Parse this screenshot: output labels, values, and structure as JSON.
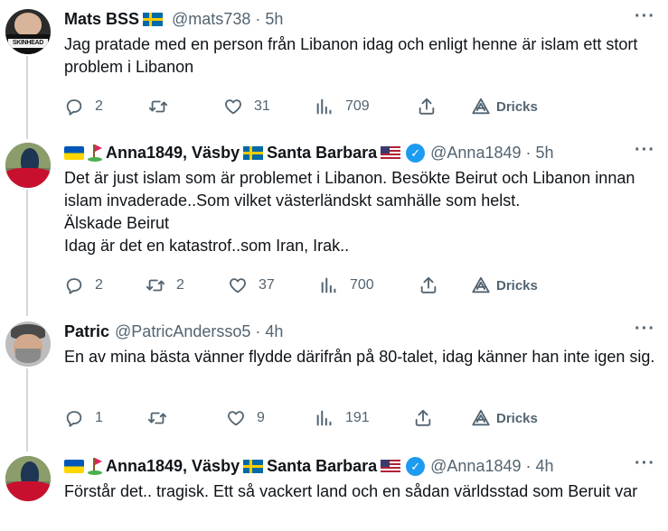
{
  "tweets": [
    {
      "name": "Mats BSS",
      "handle": "@mats738",
      "dot": "·",
      "time": "5h",
      "more": "···",
      "text": "Jag pratade med en person från Libanon idag och enligt henne är islam ett stort problem i Libanon",
      "avatar_text": "SKINHEAD",
      "replies": "2",
      "reposts": "",
      "likes": "31",
      "views": "709",
      "tip_label": "Dricks"
    },
    {
      "name": "Anna1849, Väsby",
      "name_suffix": "Santa Barbara",
      "handle": "@Anna1849",
      "dot": "·",
      "time": "5h",
      "more": "···",
      "text": "Det är just islam som är problemet i Libanon. Besökte Beirut och Libanon innan islam invaderade..Som vilket västerländskt samhälle som helst.\nÄlskade Beirut\nIdag är det en katastrof..som Iran, Irak..",
      "replies": "2",
      "reposts": "2",
      "likes": "37",
      "views": "700",
      "tip_label": "Dricks"
    },
    {
      "name": "Patric",
      "handle": "@PatricAndersso5",
      "dot": "·",
      "time": "4h",
      "more": "···",
      "text": "En av mina bästa vänner flydde därifrån på 80-talet, idag känner han inte igen sig.",
      "replies": "1",
      "reposts": "",
      "likes": "9",
      "views": "191",
      "tip_label": "Dricks"
    },
    {
      "name": "Anna1849, Väsby",
      "name_suffix": "Santa Barbara",
      "handle": "@Anna1849",
      "dot": "·",
      "time": "4h",
      "more": "···",
      "text": "Förstår det.. tragisk. Ett så vackert land och en sådan världsstad som Beruit var"
    }
  ],
  "verified_check": "✓",
  "icons": [
    "reply-icon",
    "repost-icon",
    "like-icon",
    "views-icon",
    "share-icon",
    "tip-icon",
    "verified-icon",
    "more-icon"
  ],
  "colors": {
    "text": "#0f1419",
    "secondary": "#536471",
    "verified": "#1d9bf0",
    "thread_line": "#cfd9de"
  }
}
